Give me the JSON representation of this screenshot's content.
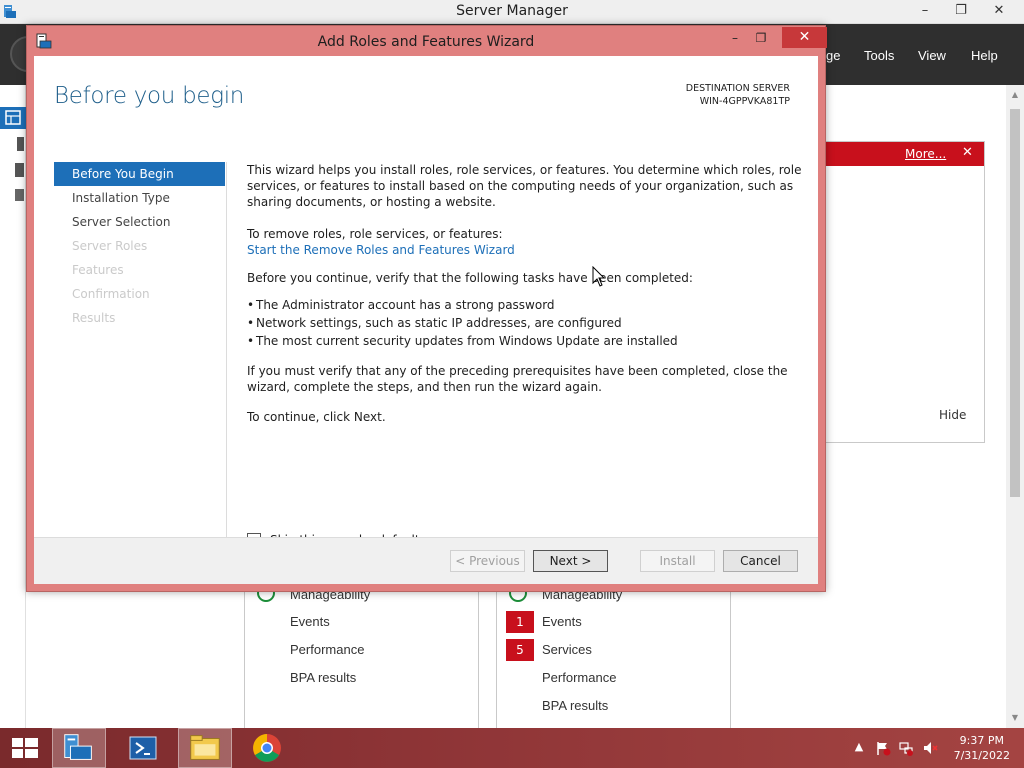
{
  "server_manager": {
    "title": "Server Manager",
    "window_controls": {
      "minimize": "–",
      "maximize": "❐",
      "close": "✕"
    },
    "menu": [
      {
        "label": "ge"
      },
      {
        "label": "Tools"
      },
      {
        "label": "View"
      },
      {
        "label": "Help"
      }
    ],
    "notification": {
      "more_label": "More...",
      "close_label": "✕",
      "hide_label": "Hide",
      "bar_color": "#c8101c"
    },
    "tile_left": {
      "rows": [
        "Manageability",
        "Events",
        "Performance",
        "BPA results"
      ]
    },
    "tile_right": {
      "rows": [
        "Manageability",
        "Events",
        "Services",
        "Performance",
        "BPA results"
      ],
      "badges": {
        "events": "1",
        "services": "5"
      }
    }
  },
  "wizard": {
    "title": "Add Roles and Features Wizard",
    "window_controls": {
      "minimize": "–",
      "maximize": "❐",
      "close": "✕"
    },
    "heading": "Before you begin",
    "destination": {
      "label": "DESTINATION SERVER",
      "server": "WIN-4GPPVKA81TP"
    },
    "steps": [
      {
        "label": "Before You Begin",
        "state": "active"
      },
      {
        "label": "Installation Type",
        "state": "enabled"
      },
      {
        "label": "Server Selection",
        "state": "enabled"
      },
      {
        "label": "Server Roles",
        "state": "disabled"
      },
      {
        "label": "Features",
        "state": "disabled"
      },
      {
        "label": "Confirmation",
        "state": "disabled"
      },
      {
        "label": "Results",
        "state": "disabled"
      }
    ],
    "intro": "This wizard helps you install roles, role services, or features. You determine which roles, role services, or features to install based on the computing needs of your organization, such as sharing documents, or hosting a website.",
    "remove_label": "To remove roles, role services, or features:",
    "remove_link": "Start the Remove Roles and Features Wizard",
    "verify_text": "Before you continue, verify that the following tasks have been completed:",
    "bullets": [
      "The Administrator account has a strong password",
      "Network settings, such as static IP addresses, are configured",
      "The most current security updates from Windows Update are installed"
    ],
    "prereq_text": "If you must verify that any of the preceding prerequisites have been completed, close the wizard, complete the steps, and then run the wizard again.",
    "continue_text": "To continue, click Next.",
    "skip_label": "Skip this page by default",
    "skip_checked": false,
    "buttons": {
      "previous": "< Previous",
      "next": "Next >",
      "install": "Install",
      "cancel": "Cancel"
    }
  },
  "taskbar": {
    "apps": [
      "start-button",
      "server-manager",
      "powershell",
      "file-explorer",
      "chrome"
    ],
    "clock": {
      "time": "9:37 PM",
      "date": "7/31/2022"
    }
  },
  "colors": {
    "wizard_frame": "#e0807f",
    "accent_blue": "#1d6fb8",
    "alert_red": "#c8101c",
    "taskbar": "#8d3436"
  }
}
